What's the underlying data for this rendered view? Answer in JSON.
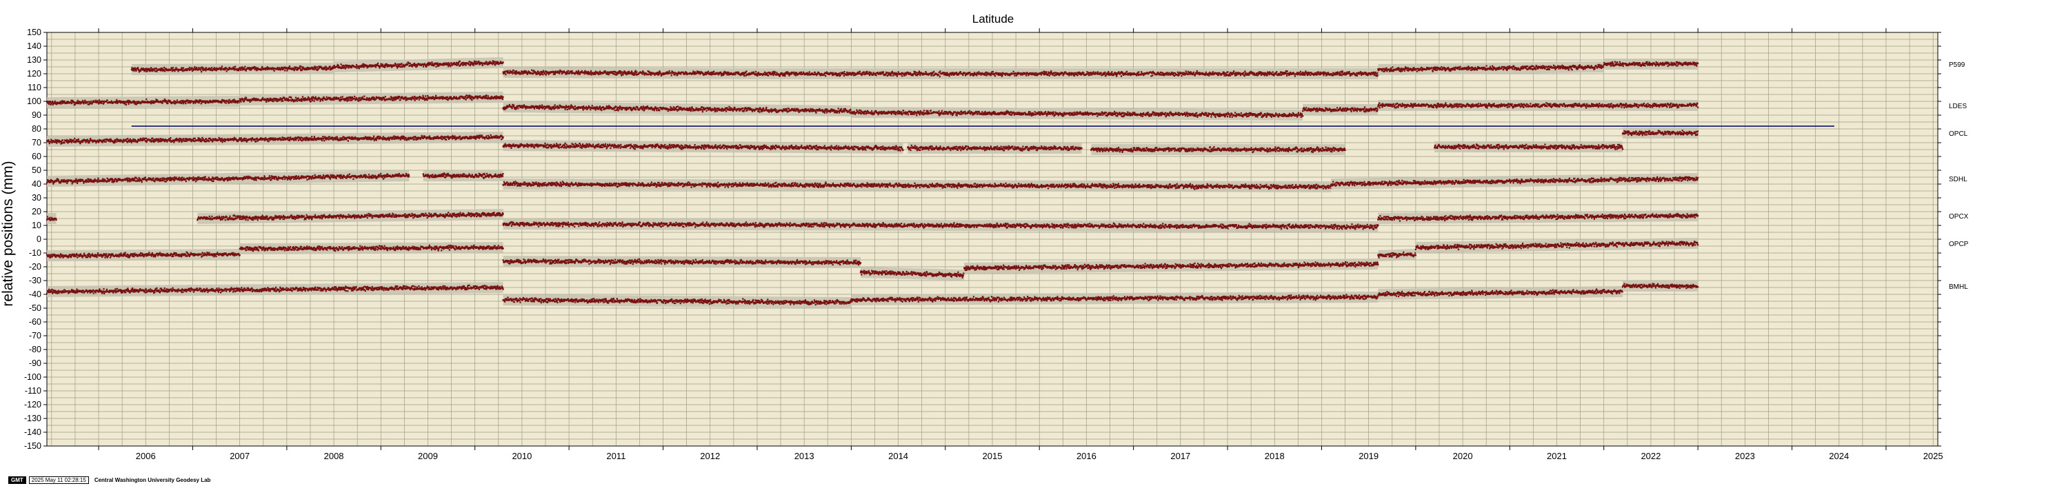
{
  "chart_data": {
    "type": "scatter",
    "title": "Latitude",
    "ylabel": "relative positions (mm)",
    "xlabel": "",
    "xlim": [
      2005.45,
      2025.55
    ],
    "ylim": [
      -150,
      150
    ],
    "y_ticks": [
      150,
      140,
      130,
      120,
      110,
      100,
      90,
      80,
      70,
      60,
      50,
      40,
      30,
      20,
      10,
      0,
      -10,
      -20,
      -30,
      -40,
      -50,
      -60,
      -70,
      -80,
      -90,
      -100,
      -110,
      -120,
      -130,
      -140,
      -150
    ],
    "x_ticks": [
      "2006",
      "2007",
      "2008",
      "2009",
      "2010",
      "2011",
      "2012",
      "2013",
      "2014",
      "2015",
      "2016",
      "2017",
      "2018",
      "2019",
      "2020",
      "2021",
      "2022",
      "2023",
      "2024",
      "2025"
    ],
    "grid": true,
    "colors": {
      "background": "#efe9d2",
      "grid": "#9c9c86",
      "points": "#7a1010",
      "error_band": "#c4c3b2",
      "reference_line": "#1b1f78"
    },
    "reference_line": {
      "y": 82,
      "x_start": 2006.35,
      "x_end": 2024.45
    },
    "series": [
      {
        "name": "P599",
        "segments": [
          {
            "x": [
              2006.35,
              2008.5
            ],
            "y": [
              123,
              124
            ]
          },
          {
            "x": [
              2008.5,
              2010.3
            ],
            "y": [
              125,
              128
            ]
          },
          {
            "x": [
              2010.3,
              2013.0
            ],
            "y": [
              121,
              120
            ]
          },
          {
            "x": [
              2013.0,
              2019.6
            ],
            "y": [
              120,
              120
            ]
          },
          {
            "x": [
              2019.6,
              2022.0
            ],
            "y": [
              123,
              125
            ]
          },
          {
            "x": [
              2022.0,
              2023.0
            ],
            "y": [
              127,
              127
            ]
          }
        ]
      },
      {
        "name": "LDES",
        "segments": [
          {
            "x": [
              2005.45,
              2007.5
            ],
            "y": [
              99,
              100
            ]
          },
          {
            "x": [
              2007.5,
              2010.3
            ],
            "y": [
              101,
              103
            ]
          },
          {
            "x": [
              2010.3,
              2014.0
            ],
            "y": [
              96,
              93
            ]
          },
          {
            "x": [
              2014.0,
              2018.8
            ],
            "y": [
              92,
              90
            ]
          },
          {
            "x": [
              2018.8,
              2019.6
            ],
            "y": [
              94,
              94
            ]
          },
          {
            "x": [
              2019.6,
              2023.0
            ],
            "y": [
              97,
              97
            ]
          }
        ]
      },
      {
        "name": "OPCL",
        "segments": [
          {
            "x": [
              2005.45,
              2010.3
            ],
            "y": [
              71,
              74
            ]
          },
          {
            "x": [
              2010.3,
              2014.55
            ],
            "y": [
              68,
              66
            ]
          },
          {
            "x": [
              2014.6,
              2016.45
            ],
            "y": [
              66,
              66
            ]
          },
          {
            "x": [
              2016.55,
              2019.25
            ],
            "y": [
              65,
              65
            ]
          },
          {
            "x": [
              2020.2,
              2022.2
            ],
            "y": [
              67,
              67
            ]
          },
          {
            "x": [
              2022.2,
              2023.0
            ],
            "y": [
              77,
              77
            ]
          }
        ]
      },
      {
        "name": "SDHL",
        "segments": [
          {
            "x": [
              2005.45,
              2009.3
            ],
            "y": [
              42,
              46
            ]
          },
          {
            "x": [
              2009.45,
              2010.3
            ],
            "y": [
              46,
              46
            ]
          },
          {
            "x": [
              2010.3,
              2019.1
            ],
            "y": [
              40,
              38
            ]
          },
          {
            "x": [
              2019.1,
              2023.0
            ],
            "y": [
              40,
              44
            ]
          }
        ]
      },
      {
        "name": "OPCX",
        "segments": [
          {
            "x": [
              2005.45,
              2005.55
            ],
            "y": [
              15,
              15
            ]
          },
          {
            "x": [
              2007.05,
              2010.3
            ],
            "y": [
              15,
              18
            ]
          },
          {
            "x": [
              2010.3,
              2019.6
            ],
            "y": [
              11,
              9
            ]
          },
          {
            "x": [
              2019.6,
              2023.0
            ],
            "y": [
              15,
              17
            ]
          }
        ]
      },
      {
        "name": "OPCP",
        "segments": [
          {
            "x": [
              2005.45,
              2007.5
            ],
            "y": [
              -12,
              -11
            ]
          },
          {
            "x": [
              2007.5,
              2010.3
            ],
            "y": [
              -7,
              -6
            ]
          },
          {
            "x": [
              2010.3,
              2014.1
            ],
            "y": [
              -16,
              -17
            ]
          },
          {
            "x": [
              2014.1,
              2015.2
            ],
            "y": [
              -24,
              -26
            ]
          },
          {
            "x": [
              2015.2,
              2019.6
            ],
            "y": [
              -21,
              -18
            ]
          },
          {
            "x": [
              2019.6,
              2020.0
            ],
            "y": [
              -12,
              -11
            ]
          },
          {
            "x": [
              2020.0,
              2023.0
            ],
            "y": [
              -6,
              -3
            ]
          }
        ]
      },
      {
        "name": "BMHL",
        "segments": [
          {
            "x": [
              2005.45,
              2010.3
            ],
            "y": [
              -38,
              -35
            ]
          },
          {
            "x": [
              2010.3,
              2014.0
            ],
            "y": [
              -44,
              -46
            ]
          },
          {
            "x": [
              2014.0,
              2019.6
            ],
            "y": [
              -44,
              -42
            ]
          },
          {
            "x": [
              2019.6,
              2022.2
            ],
            "y": [
              -40,
              -38
            ]
          },
          {
            "x": [
              2022.2,
              2023.0
            ],
            "y": [
              -34,
              -34
            ]
          }
        ]
      }
    ]
  },
  "footer": {
    "logo": "GMT",
    "stamp": "2025 May 11 02:28:15",
    "org": "Central Washington University Geodesy Lab"
  }
}
